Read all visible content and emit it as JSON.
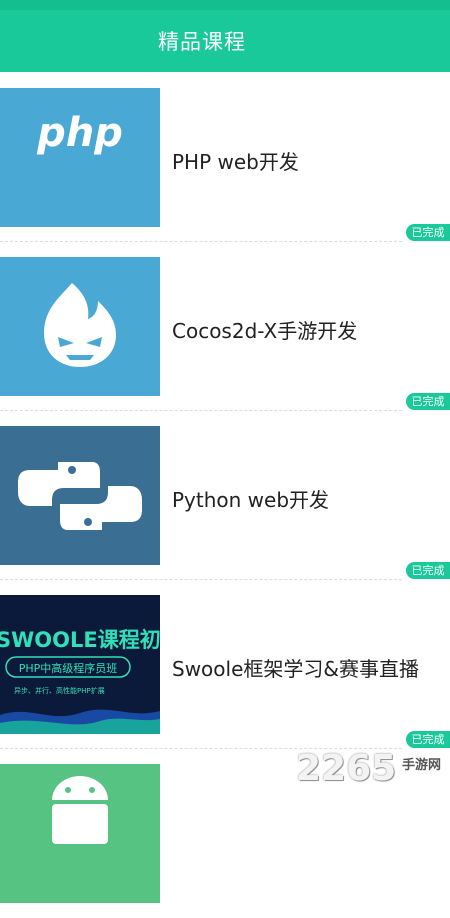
{
  "header": {
    "title": "精品课程"
  },
  "courses": [
    {
      "title": "PHP web开发",
      "status": "已完成",
      "thumb_icon": "php-logo-icon",
      "thumb_text": "php"
    },
    {
      "title": "Cocos2d-X手游开发",
      "status": "已完成",
      "thumb_icon": "cocos-flame-icon"
    },
    {
      "title": "Python web开发",
      "status": "已完成",
      "thumb_icon": "python-logo-icon"
    },
    {
      "title": "Swoole框架学习&赛事直播",
      "status": "已完成",
      "thumb_icon": "swoole-banner-icon",
      "banner_title": "SWOOLE课程初探",
      "banner_sub": "PHP中高级程序员班",
      "banner_tags": "异步、并行、高性能PHP扩展"
    },
    {
      "title": "",
      "status": "",
      "thumb_icon": "android-icon"
    }
  ],
  "watermark": {
    "number": "2265",
    "text": "手游网"
  },
  "colors": {
    "accent": "#19c99a",
    "php_bg": "#4aa8d4",
    "cocos_bg": "#4aa8d4",
    "python_bg": "#3b6e93",
    "swoole_bg": "#0b1a3a",
    "android_bg": "#57c383"
  }
}
